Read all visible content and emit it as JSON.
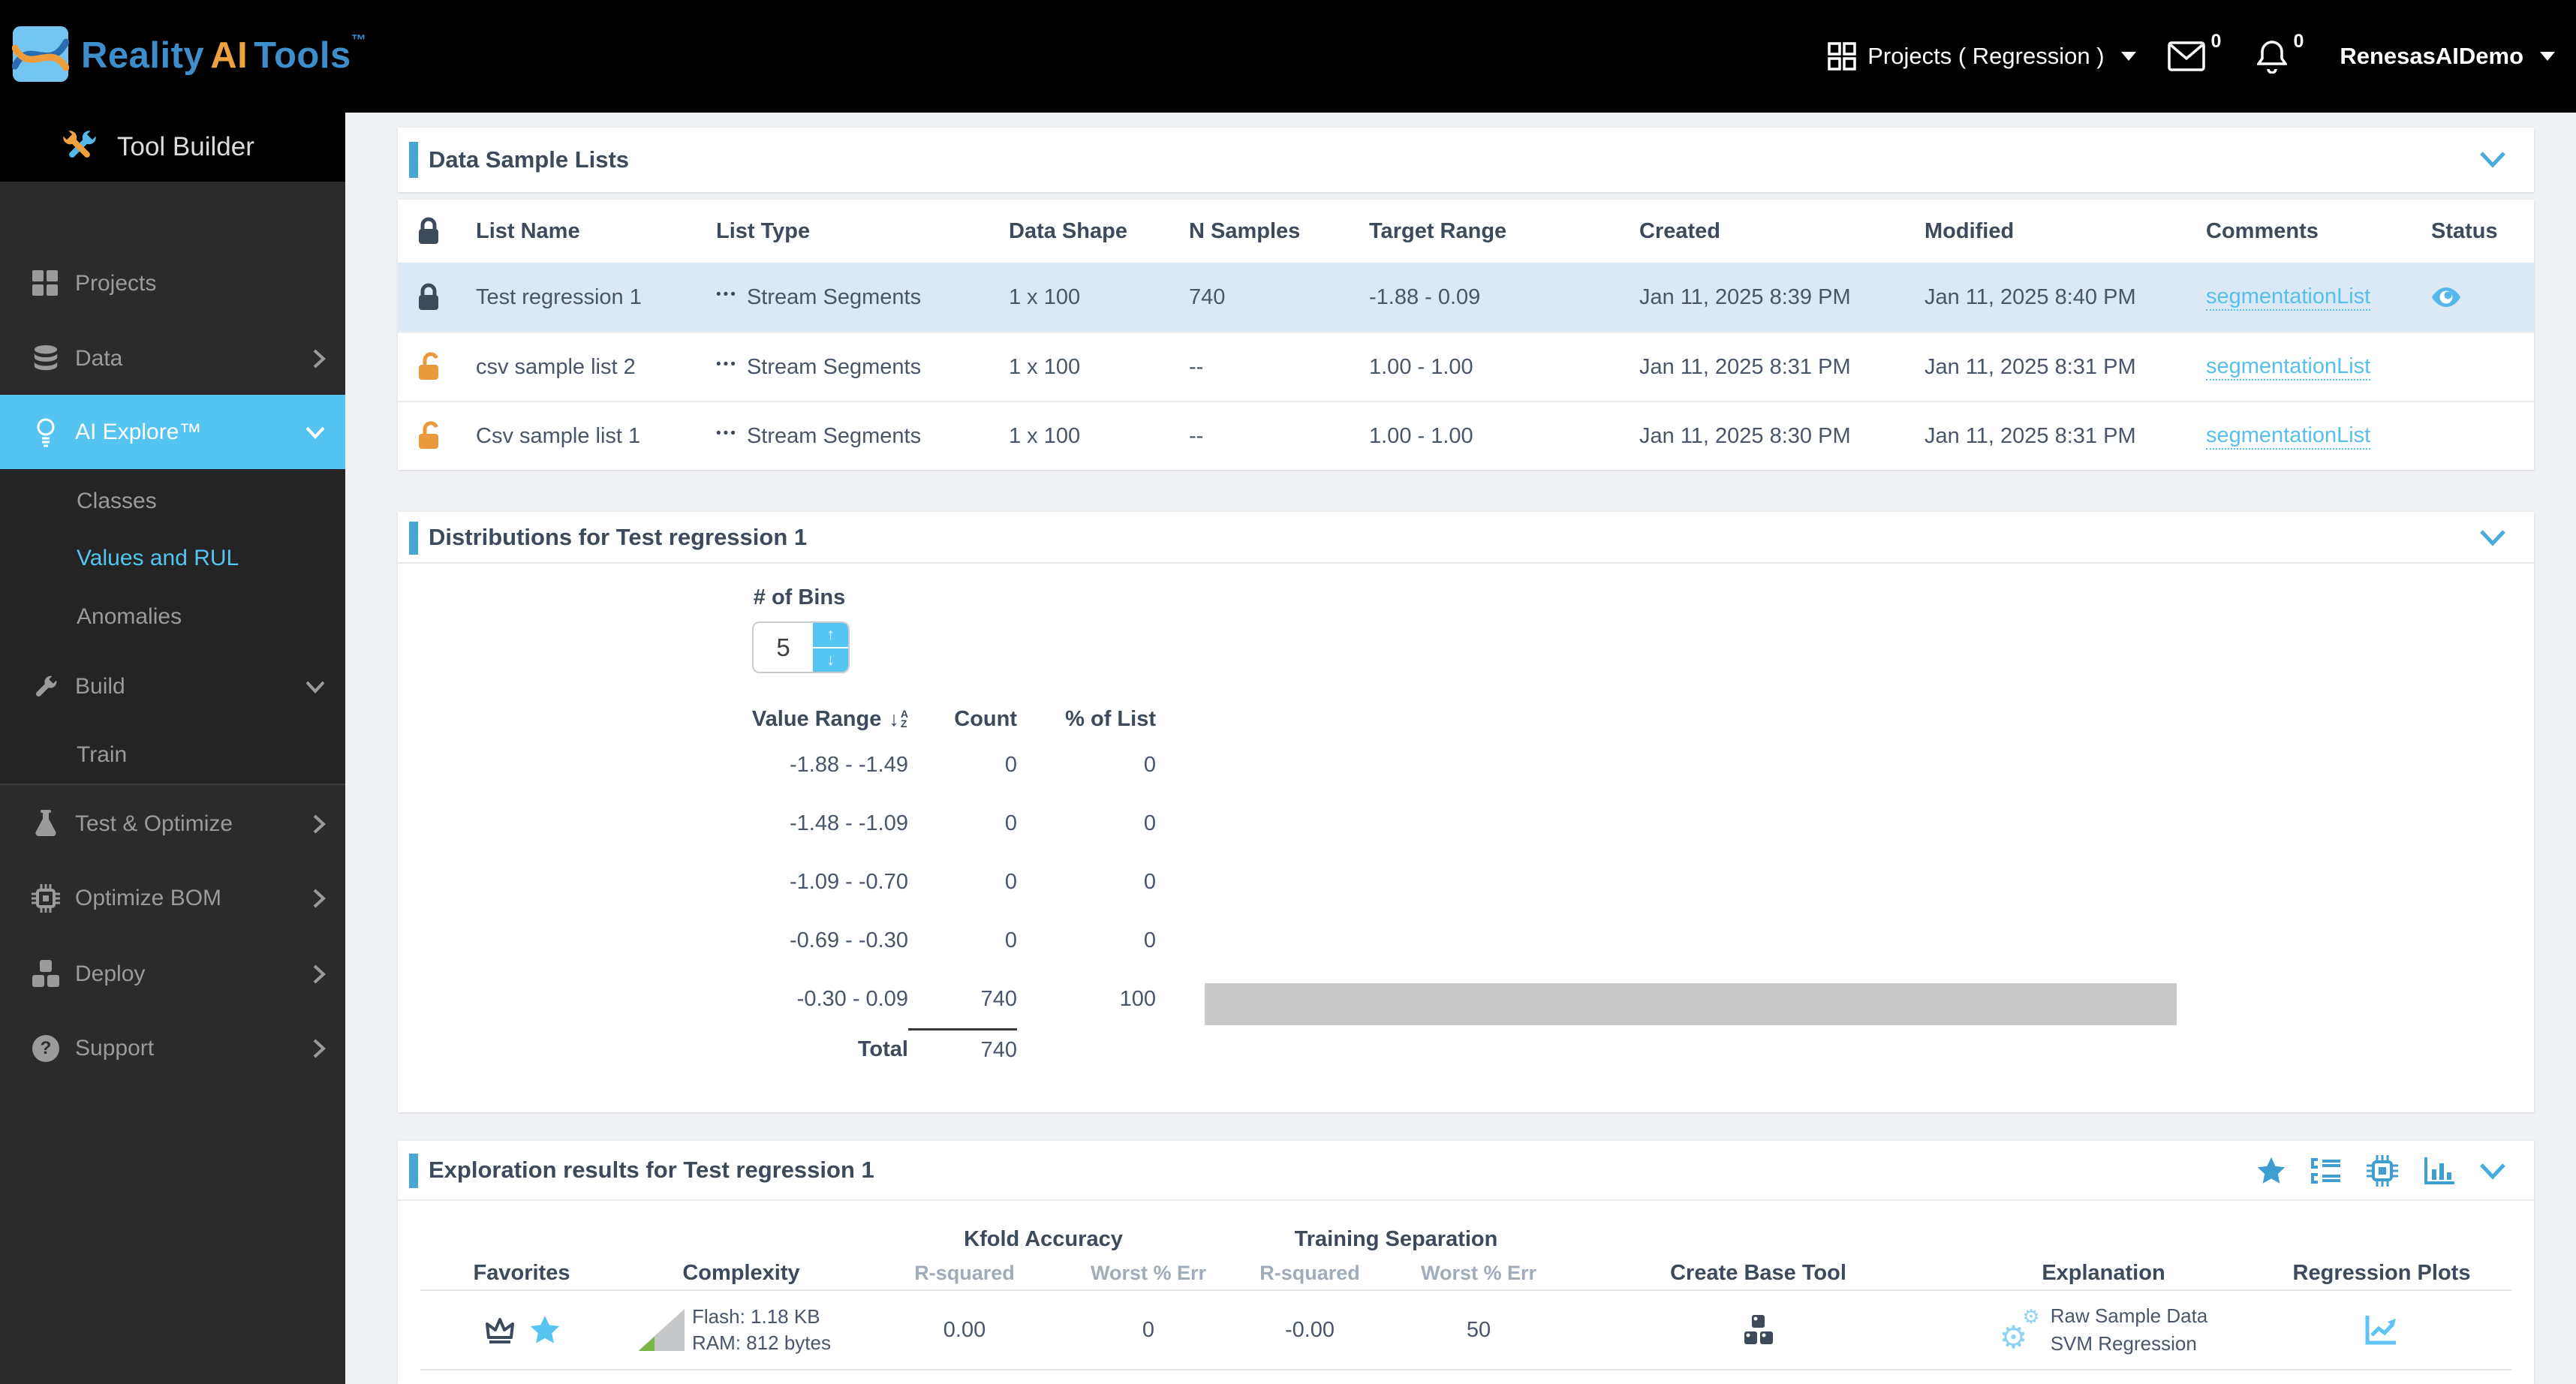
{
  "colors": {
    "accent_blue": "#45a8d4",
    "highlight_blue": "#55c4f0",
    "link_blue": "#58bfec",
    "selected_row_blue": "#dbe9f6",
    "lock_orange": "#e89a3d",
    "dark_slate": "#3d4a5c",
    "complexity_green": "#79b544",
    "bar_gray": "#c9c9c9"
  },
  "topbar": {
    "brand_reality": "Reality",
    "brand_ai": "AI",
    "brand_tools": "Tools",
    "brand_tm": "™",
    "projects_menu": "Projects ( Regression )",
    "mail_count": "0",
    "alerts_count": "0",
    "user": "RenesasAIDemo"
  },
  "sidebar": {
    "title": "Tool Builder",
    "items": [
      {
        "label": "Projects"
      },
      {
        "label": "Data"
      },
      {
        "label": "AI Explore™"
      },
      {
        "label": "Classes"
      },
      {
        "label": "Values and RUL"
      },
      {
        "label": "Anomalies"
      },
      {
        "label": "Build"
      },
      {
        "label": "Train"
      },
      {
        "label": "Test & Optimize"
      },
      {
        "label": "Optimize BOM"
      },
      {
        "label": "Deploy"
      },
      {
        "label": "Support"
      }
    ]
  },
  "data_sample_lists": {
    "title": "Data Sample Lists",
    "columns": {
      "name": "List Name",
      "type": "List Type",
      "shape": "Data Shape",
      "nsamples": "N Samples",
      "target": "Target Range",
      "created": "Created",
      "modified": "Modified",
      "comments": "Comments",
      "status": "Status"
    },
    "rows": [
      {
        "name": "Test regression 1",
        "type": "Stream Segments",
        "shape": "1 x 100",
        "nsamples": "740",
        "target": "-1.88 - 0.09",
        "created": "Jan 11, 2025 8:39 PM",
        "modified": "Jan 11, 2025 8:40 PM",
        "comments": "segmentationList",
        "locked": "closed"
      },
      {
        "name": "csv sample list 2",
        "type": "Stream Segments",
        "shape": "1 x 100",
        "nsamples": "--",
        "target": "1.00 - 1.00",
        "created": "Jan 11, 2025 8:31 PM",
        "modified": "Jan 11, 2025 8:31 PM",
        "comments": "segmentationList",
        "locked": "open"
      },
      {
        "name": "Csv sample list 1",
        "type": "Stream Segments",
        "shape": "1 x 100",
        "nsamples": "--",
        "target": "1.00 - 1.00",
        "created": "Jan 11, 2025 8:30 PM",
        "modified": "Jan 11, 2025 8:31 PM",
        "comments": "segmentationList",
        "locked": "open"
      }
    ]
  },
  "distributions": {
    "title": "Distributions for Test regression 1",
    "bins_label": "# of Bins",
    "bins_value": "5",
    "columns": {
      "range": "Value Range",
      "count": "Count",
      "pct": "% of List"
    },
    "rows": [
      {
        "range": "-1.88 - -1.49",
        "count": "0",
        "pct": "0"
      },
      {
        "range": "-1.48 - -1.09",
        "count": "0",
        "pct": "0"
      },
      {
        "range": "-1.09 - -0.70",
        "count": "0",
        "pct": "0"
      },
      {
        "range": "-0.69 - -0.30",
        "count": "0",
        "pct": "0"
      },
      {
        "range": "-0.30 - 0.09",
        "count": "740",
        "pct": "100"
      }
    ],
    "total_label": "Total",
    "total_count": "740",
    "bar_pct": 100
  },
  "exploration": {
    "title": "Exploration results for Test regression 1",
    "groups": {
      "kfold": "Kfold Accuracy",
      "training": "Training Separation"
    },
    "columns": {
      "favorites": "Favorites",
      "complexity": "Complexity",
      "r2_kfold": "R-squared",
      "worst_kfold": "Worst % Err",
      "r2_train": "R-squared",
      "worst_train": "Worst % Err",
      "create": "Create Base Tool",
      "explanation": "Explanation",
      "plots": "Regression Plots"
    },
    "row": {
      "flash": "Flash: 1.18 KB",
      "ram": "RAM: 812 bytes",
      "r2_kfold": "0.00",
      "worst_kfold": "0",
      "r2_train": "-0.00",
      "worst_train": "50",
      "explanation_line1": "Raw Sample Data",
      "explanation_line2": "SVM Regression"
    }
  },
  "icons": {
    "dots": "•••",
    "up_arrow": "↑",
    "down_arrow": "↓",
    "sort_arrow": "↓",
    "sort_a": "A",
    "sort_z": "Z",
    "gear": "⚙",
    "question": "?"
  }
}
